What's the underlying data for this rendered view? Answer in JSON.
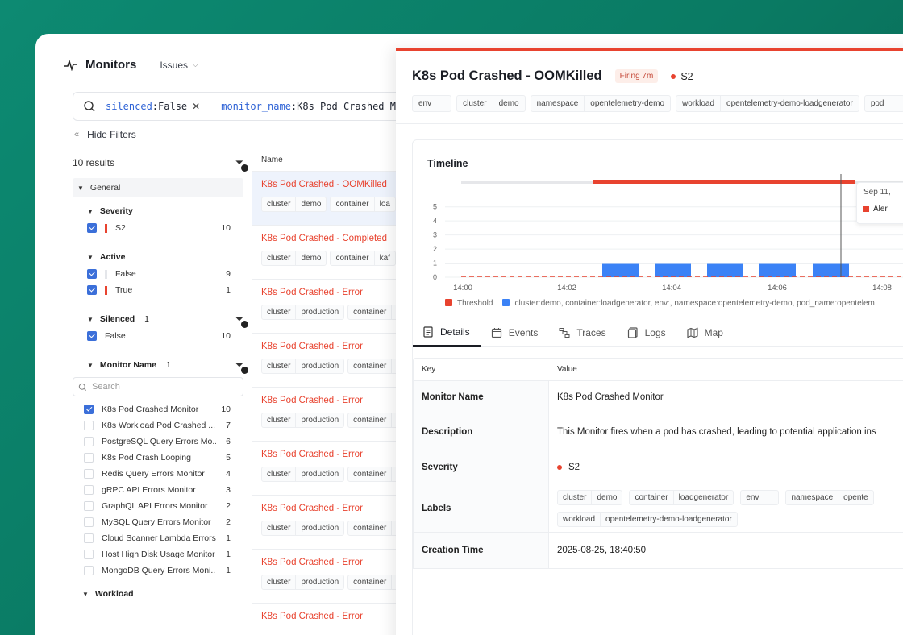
{
  "header": {
    "title": "Monitors",
    "issues_label": "Issues"
  },
  "search": {
    "tokens": [
      {
        "key": "silenced",
        "value": "False"
      },
      {
        "key": "monitor_name",
        "value": "K8s Pod Crashed M"
      }
    ]
  },
  "filters": {
    "hide_label": "Hide Filters",
    "results": "10 results",
    "general": "General",
    "severity": {
      "title": "Severity",
      "items": [
        {
          "label": "S2",
          "count": "10"
        }
      ]
    },
    "active": {
      "title": "Active",
      "items": [
        {
          "label": "False",
          "count": "9"
        },
        {
          "label": "True",
          "count": "1"
        }
      ]
    },
    "silenced": {
      "title": "Silenced",
      "badge": "1",
      "items": [
        {
          "label": "False",
          "count": "10"
        }
      ]
    },
    "monitor_name": {
      "title": "Monitor Name",
      "badge": "1",
      "search_placeholder": "Search",
      "items": [
        {
          "label": "K8s Pod Crashed Monitor",
          "count": "10",
          "checked": true
        },
        {
          "label": "K8s Workload Pod Crashed ...",
          "count": "7"
        },
        {
          "label": "PostgreSQL Query Errors Mo...",
          "count": "6"
        },
        {
          "label": "K8s Pod Crash Looping",
          "count": "5"
        },
        {
          "label": "Redis Query Errors Monitor",
          "count": "4"
        },
        {
          "label": "gRPC API Errors Monitor",
          "count": "3"
        },
        {
          "label": "GraphQL API Errors Monitor",
          "count": "2"
        },
        {
          "label": "MySQL Query Errors Monitor",
          "count": "2"
        },
        {
          "label": "Cloud Scanner Lambda Errors",
          "count": "1"
        },
        {
          "label": "Host High Disk Usage Monitor",
          "count": "1"
        },
        {
          "label": "MongoDB Query Errors Moni...",
          "count": "1"
        }
      ]
    },
    "workload": {
      "title": "Workload"
    }
  },
  "list": {
    "header": "Name",
    "items": [
      {
        "title": "K8s Pod Crashed - OOMKilled",
        "tags": [
          [
            "cluster",
            "demo"
          ],
          [
            "container",
            "loa"
          ]
        ]
      },
      {
        "title": "K8s Pod Crashed - Completed",
        "tags": [
          [
            "cluster",
            "demo"
          ],
          [
            "container",
            "kaf"
          ]
        ]
      },
      {
        "title": "K8s Pod Crashed - Error",
        "tags": [
          [
            "cluster",
            "production"
          ],
          [
            "container",
            ""
          ]
        ]
      },
      {
        "title": "K8s Pod Crashed - Error",
        "tags": [
          [
            "cluster",
            "production"
          ],
          [
            "container",
            ""
          ]
        ]
      },
      {
        "title": "K8s Pod Crashed - Error",
        "tags": [
          [
            "cluster",
            "production"
          ],
          [
            "container",
            ""
          ]
        ]
      },
      {
        "title": "K8s Pod Crashed - Error",
        "tags": [
          [
            "cluster",
            "production"
          ],
          [
            "container",
            ""
          ]
        ]
      },
      {
        "title": "K8s Pod Crashed - Error",
        "tags": [
          [
            "cluster",
            "production"
          ],
          [
            "container",
            ""
          ]
        ]
      },
      {
        "title": "K8s Pod Crashed - Error",
        "tags": [
          [
            "cluster",
            "production"
          ],
          [
            "container",
            ""
          ]
        ]
      },
      {
        "title": "K8s Pod Crashed - Error",
        "tags": []
      }
    ]
  },
  "detail": {
    "title": "K8s Pod Crashed - OOMKilled",
    "status": "Firing 7m",
    "severity": "S2",
    "tags": [
      [
        "env",
        ""
      ],
      [
        "cluster",
        "demo"
      ],
      [
        "namespace",
        "opentelemetry-demo"
      ],
      [
        "workload",
        "opentelemetry-demo-loadgenerator"
      ],
      [
        "pod",
        ""
      ]
    ],
    "timeline_title": "Timeline",
    "tooltip": {
      "date": "Sep 11,",
      "series": "Aler"
    },
    "legend": [
      {
        "label": "Threshold",
        "color": "#e8432f"
      },
      {
        "label": "cluster:demo, container:loadgenerator, env:, namespace:opentelemetry-demo, pod_name:opentelem",
        "color": "#3b82f6"
      }
    ],
    "tabs": [
      "Details",
      "Events",
      "Traces",
      "Logs",
      "Map"
    ],
    "table": {
      "key_header": "Key",
      "value_header": "Value",
      "monitor_name_label": "Monitor Name",
      "monitor_name_value": "K8s Pod Crashed Monitor",
      "description_label": "Description",
      "description_value": "This Monitor fires when a pod has crashed, leading to potential application ins",
      "severity_label": "Severity",
      "severity_value": "S2",
      "labels_label": "Labels",
      "labels": [
        [
          "cluster",
          "demo"
        ],
        [
          "container",
          "loadgenerator"
        ],
        [
          "env",
          ""
        ],
        [
          "namespace",
          "opente"
        ],
        [
          "workload",
          "opentelemetry-demo-loadgenerator"
        ]
      ],
      "creation_label": "Creation Time",
      "creation_value": "2025-08-25, 18:40:50"
    }
  },
  "chart_data": {
    "type": "bar",
    "x_ticks": [
      "14:00",
      "14:02",
      "14:04",
      "14:06",
      "14:08"
    ],
    "y_ticks": [
      0,
      1,
      2,
      3,
      4,
      5
    ],
    "ylim": [
      0,
      5.5
    ],
    "series": [
      {
        "name": "cluster:demo, container:loadgenerator, env:, namespace:opentelemetry-demo, pod_name:opentelem",
        "values": [
          1,
          1,
          1,
          1,
          1
        ]
      }
    ],
    "threshold": 0,
    "colors": {
      "bar": "#3b82f6",
      "threshold": "#e8432f"
    }
  }
}
